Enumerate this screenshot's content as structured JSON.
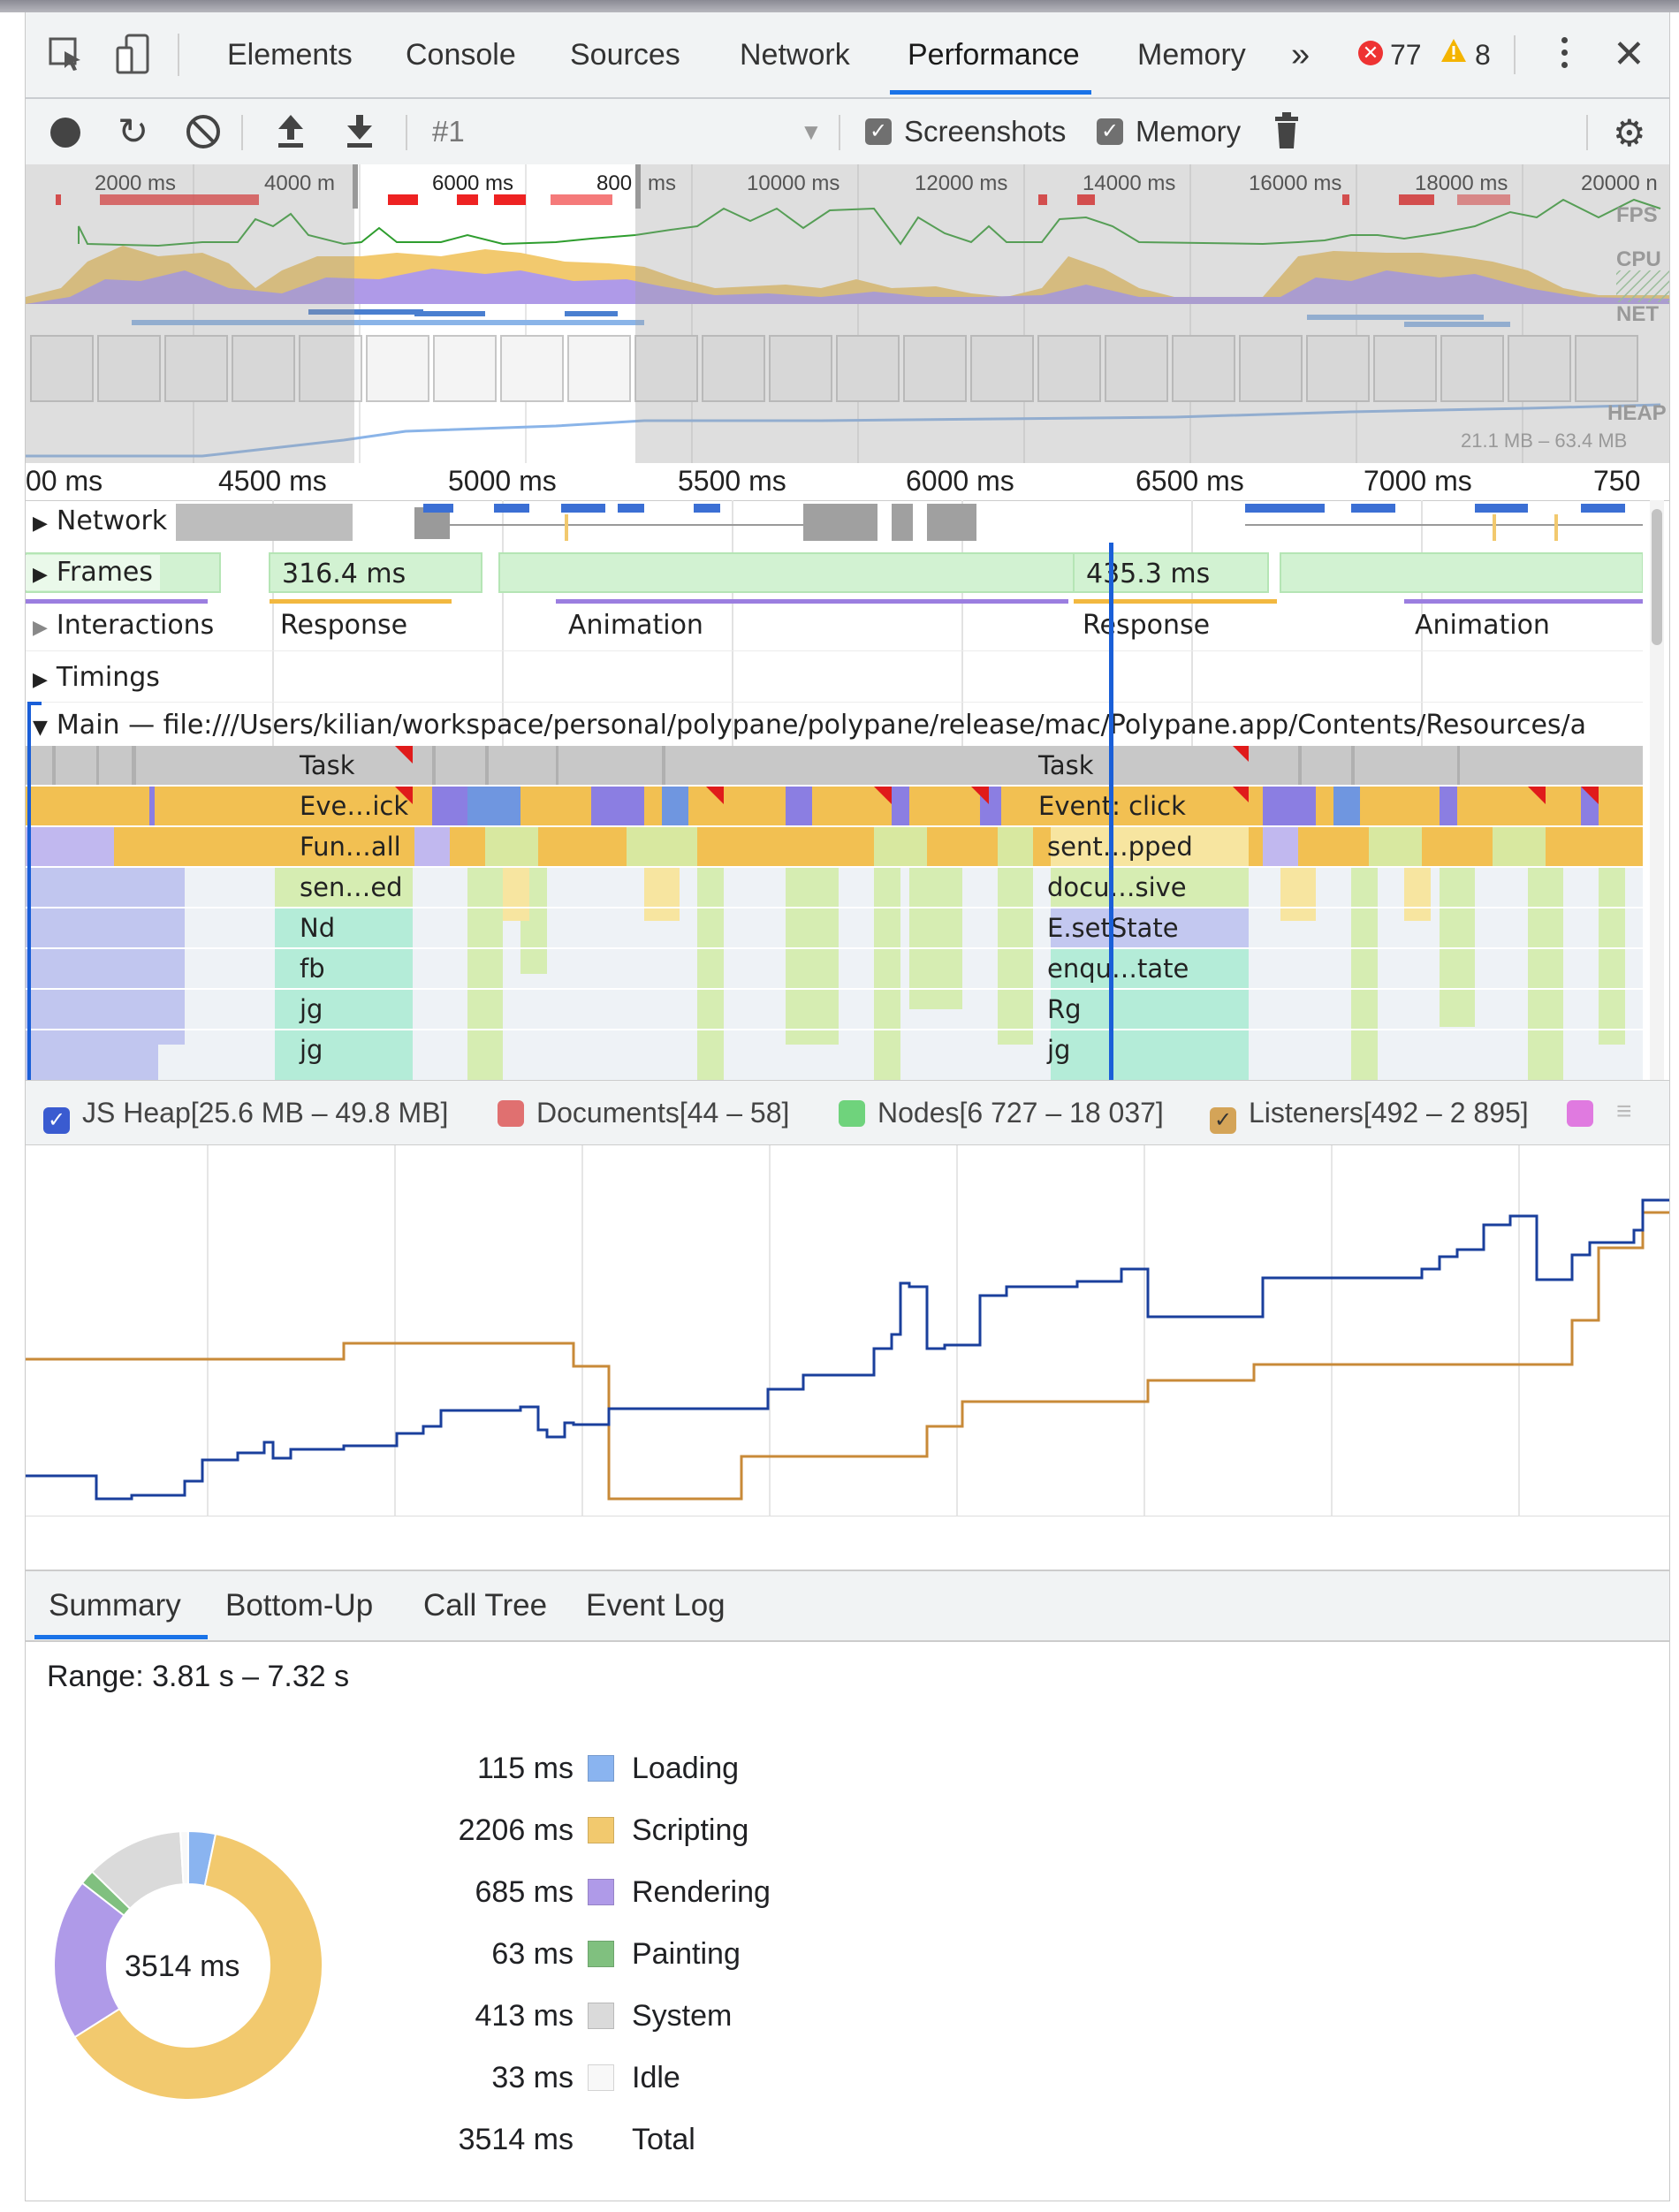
{
  "tabs": {
    "items": [
      "Elements",
      "Console",
      "Sources",
      "Network",
      "Performance",
      "Memory"
    ],
    "active": "Performance",
    "more": "»",
    "error_count": "77",
    "warning_count": "8"
  },
  "toolbar": {
    "profile": "#1",
    "screenshots_label": "Screenshots",
    "memory_label": "Memory"
  },
  "overview": {
    "ticks": [
      "2000 ms",
      "4000 m",
      "6000 ms",
      "800",
      "ms",
      "10000 ms",
      "12000 ms",
      "14000 ms",
      "16000 ms",
      "18000 ms",
      "20000 n"
    ],
    "fps": "FPS",
    "cpu": "CPU",
    "net": "NET",
    "heap": "HEAP",
    "heap_range": "21.1 MB – 63.4 MB"
  },
  "ruler": {
    "ticks": [
      "00 ms",
      "4500 ms",
      "5000 ms",
      "5500 ms",
      "6000 ms",
      "6500 ms",
      "7000 ms",
      "750"
    ]
  },
  "tracks": {
    "network": "Network",
    "frames": "Frames",
    "frame1": "316.4 ms",
    "frame2": "435.3 ms",
    "interactions": "Interactions",
    "int_response1": "Response",
    "int_animation1": "Animation",
    "int_response2": "Response",
    "int_animation2": "Animation",
    "timings": "Timings",
    "main": "Main — file:///Users/kilian/workspace/personal/polypane/polypane/release/mac/Polypane.app/Contents/Resources/a"
  },
  "flame": {
    "left": [
      "Task",
      "Eve…ick",
      "Fun…all",
      "sen…ed",
      "Nd",
      "fb",
      "jg",
      "jg"
    ],
    "right": [
      "Task",
      "Event: click",
      "sent…pped",
      "docu…sive",
      "E.setState",
      "enqu…tate",
      "Rg",
      "jg"
    ]
  },
  "memory": {
    "js_heap": "JS Heap[25.6 MB – 49.8 MB]",
    "documents": "Documents[44 – 58]",
    "nodes": "Nodes[6 727 – 18 037]",
    "listeners": "Listeners[492 – 2 895]",
    "colors": {
      "heap": "#1a4fa8",
      "documents": "#e06b6b",
      "nodes": "#6fd37c",
      "listeners": "#c88a38",
      "gpu": "#e07ae0"
    }
  },
  "bottom_tabs": [
    "Summary",
    "Bottom-Up",
    "Call Tree",
    "Event Log"
  ],
  "summary": {
    "range": "Range: 3.81 s – 7.32 s",
    "total_center": "3514 ms",
    "rows": [
      {
        "value": "115 ms",
        "label": "Loading",
        "color": "#8ab4f0"
      },
      {
        "value": "2206 ms",
        "label": "Scripting",
        "color": "#f2c96e"
      },
      {
        "value": "685 ms",
        "label": "Rendering",
        "color": "#af9ae8"
      },
      {
        "value": "63 ms",
        "label": "Painting",
        "color": "#80c07f"
      },
      {
        "value": "413 ms",
        "label": "System",
        "color": "#dadada"
      },
      {
        "value": "33 ms",
        "label": "Idle",
        "color": "#f8f8f8"
      },
      {
        "value": "3514 ms",
        "label": "Total",
        "color": ""
      }
    ]
  }
}
